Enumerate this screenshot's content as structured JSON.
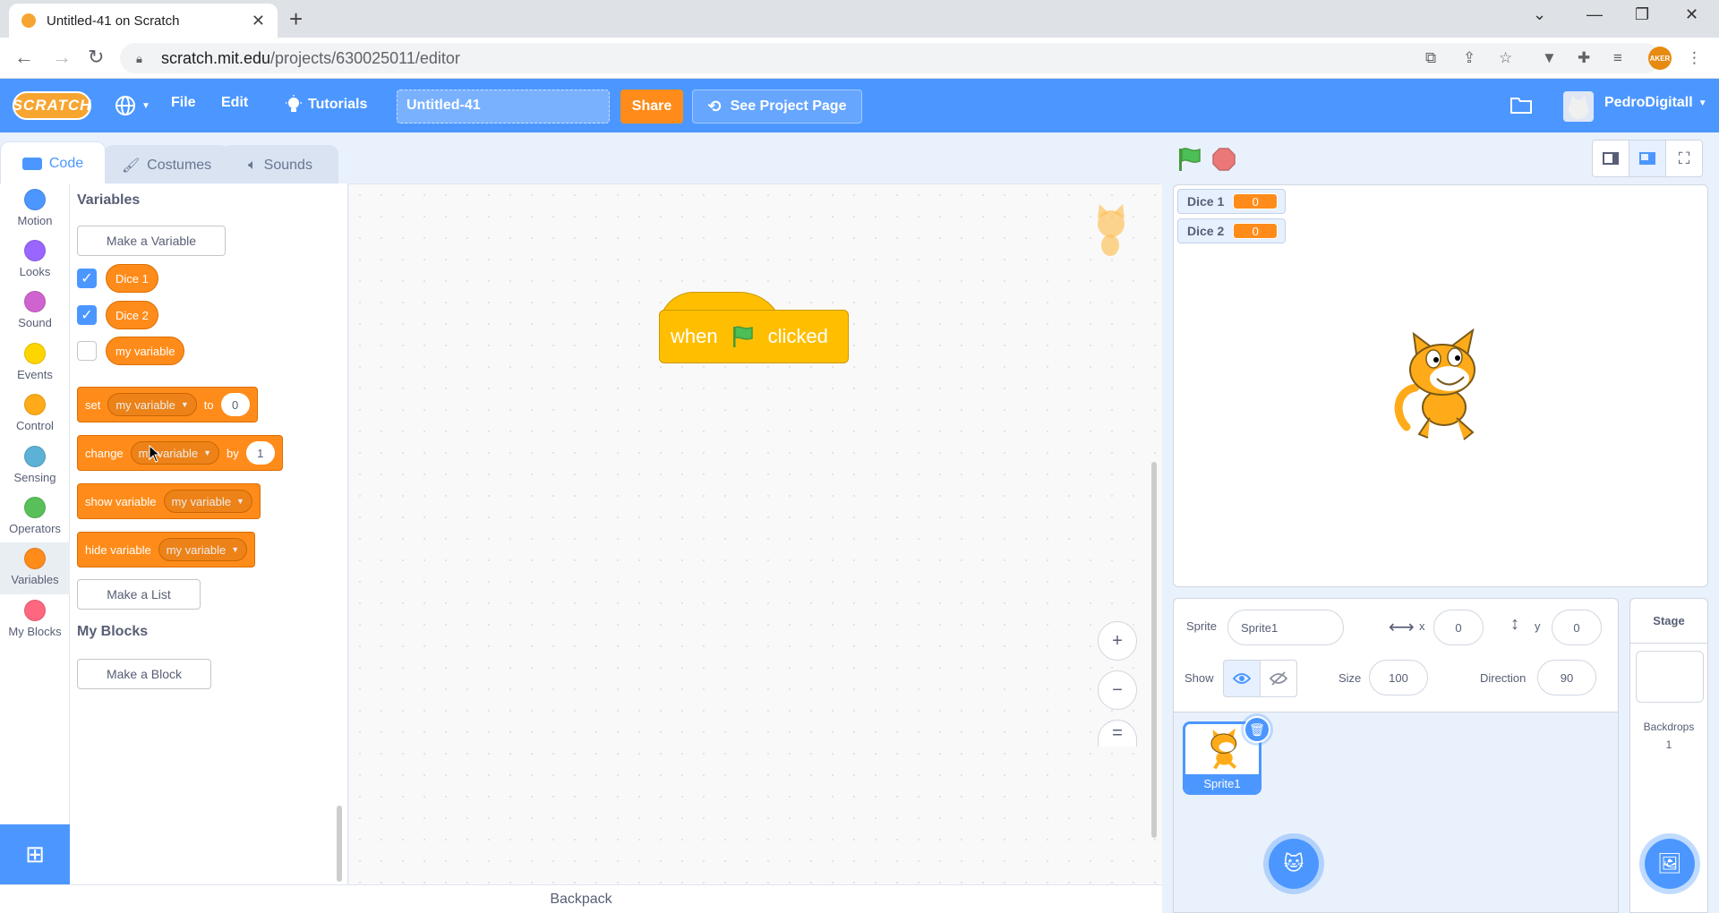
{
  "browser": {
    "tab_title": "Untitled-41 on Scratch",
    "url_host": "scratch.mit.edu",
    "url_path": "/projects/630025011/editor",
    "profile_label": "AKER"
  },
  "menubar": {
    "logo": "SCRATCH",
    "file": "File",
    "edit": "Edit",
    "tutorials": "Tutorials",
    "project_title": "Untitled-41",
    "share": "Share",
    "see_project": "See Project Page",
    "username": "PedroDigitall"
  },
  "tabs": {
    "code": "Code",
    "costumes": "Costumes",
    "sounds": "Sounds"
  },
  "categories": [
    {
      "label": "Motion",
      "color": "#4c97ff"
    },
    {
      "label": "Looks",
      "color": "#9966ff"
    },
    {
      "label": "Sound",
      "color": "#cf63cf"
    },
    {
      "label": "Events",
      "color": "#ffd500"
    },
    {
      "label": "Control",
      "color": "#ffab19"
    },
    {
      "label": "Sensing",
      "color": "#5cb1d6"
    },
    {
      "label": "Operators",
      "color": "#59c059"
    },
    {
      "label": "Variables",
      "color": "#ff8c1a"
    },
    {
      "label": "My Blocks",
      "color": "#ff6680"
    }
  ],
  "palette": {
    "variables_heading": "Variables",
    "make_variable": "Make a Variable",
    "variables": [
      {
        "name": "Dice 1",
        "checked": true
      },
      {
        "name": "Dice 2",
        "checked": true
      },
      {
        "name": "my variable",
        "checked": false
      }
    ],
    "set_block": {
      "label": "set",
      "var": "my variable",
      "to": "to",
      "value": "0"
    },
    "change_block": {
      "label": "change",
      "var": "my variable",
      "by": "by",
      "value": "1"
    },
    "show_block": {
      "label": "show variable",
      "var": "my variable"
    },
    "hide_block": {
      "label": "hide variable",
      "var": "my variable"
    },
    "make_list": "Make a List",
    "myblocks_heading": "My Blocks",
    "make_block": "Make a Block"
  },
  "workspace": {
    "hat_when": "when",
    "hat_clicked": "clicked",
    "zoom_in": "+",
    "zoom_out": "−",
    "zoom_reset": "="
  },
  "backpack": "Backpack",
  "stage": {
    "monitors": [
      {
        "name": "Dice 1",
        "value": "0"
      },
      {
        "name": "Dice 2",
        "value": "0"
      }
    ]
  },
  "sprite_info": {
    "sprite_label": "Sprite",
    "sprite_name": "Sprite1",
    "x_label": "x",
    "x_value": "0",
    "y_label": "y",
    "y_value": "0",
    "show_label": "Show",
    "size_label": "Size",
    "size_value": "100",
    "direction_label": "Direction",
    "direction_value": "90"
  },
  "sprites": [
    {
      "name": "Sprite1"
    }
  ],
  "stage_pane": {
    "title": "Stage",
    "backdrops_label": "Backdrops",
    "backdrops_count": "1"
  }
}
